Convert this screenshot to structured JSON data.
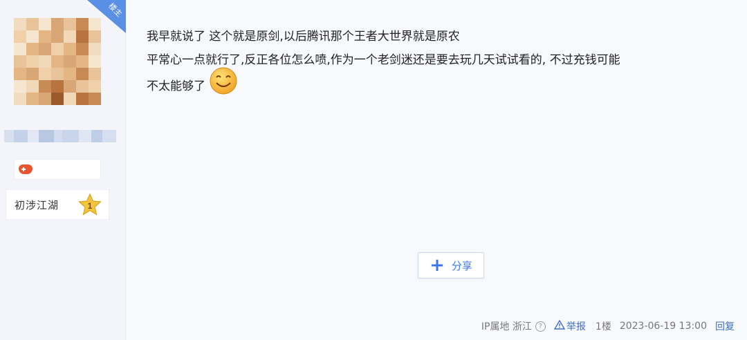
{
  "sidebar": {
    "badge_text": "楼主",
    "level_name": "初涉江湖",
    "level_number": "1",
    "game_icon": "gamepad-icon",
    "colors": {
      "game_icon": "#e7552f",
      "star": "#f2c53d"
    }
  },
  "post": {
    "lines": [
      "我早就说了 这个就是原剑,以后腾讯那个王者大世界就是原农",
      "平常心一点就行了,反正各位怎么喷,作为一个老剑迷还是要去玩几天试试看的, 不过充钱可能",
      "不太能够了"
    ],
    "emoji": "smiley-icon"
  },
  "share": {
    "label": "分享",
    "icon": "plus-icon"
  },
  "footer": {
    "ip_label": "IP属地 浙江",
    "help_icon": "?",
    "report_label": "举报",
    "floor": "1楼",
    "time": "2023-06-19 13:00",
    "reply_label": "回复"
  },
  "colors": {
    "accent": "#3b78e7",
    "link": "#3b6fc4",
    "background": "#f7f9fd"
  }
}
